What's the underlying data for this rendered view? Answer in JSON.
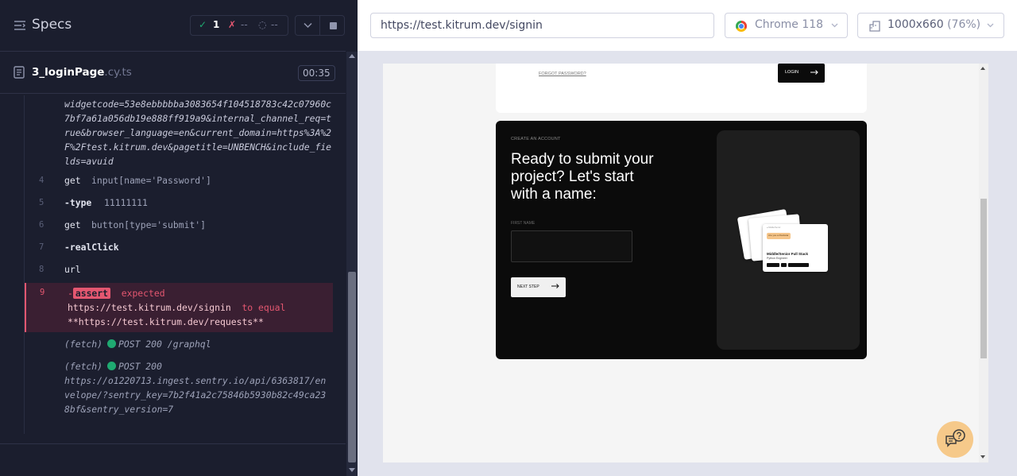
{
  "reporter": {
    "title": "Specs",
    "stats": {
      "passed": "1",
      "failed": "--",
      "pending": "--"
    },
    "spec": {
      "name": "3_loginPage",
      "ext": ".cy.ts",
      "duration": "00:35"
    },
    "commands": {
      "url_continuation": "widgetcode=53e8ebbbbba3083654f104518783c42c07960c7bf7a61a056db19e888ff919a9&internal_channel_req=true&browser_language=en&current_domain=https%3A%2F%2Ftest.kitrum.dev&pagetitle=UNBENCH&include_fields=avuid",
      "rows": [
        {
          "line": "4",
          "name": "get",
          "message": "input[name='Password']"
        },
        {
          "line": "5",
          "name": "-type",
          "message": "11111111"
        },
        {
          "line": "6",
          "name": "get",
          "message": "button[type='submit']"
        },
        {
          "line": "7",
          "name": "-realClick",
          "message": ""
        },
        {
          "line": "8",
          "name": "url",
          "message": ""
        }
      ],
      "assert": {
        "line": "9",
        "badge": "assert",
        "expected_label": "expected",
        "actual": "https://test.kitrum.dev/signin",
        "to_equal": "to equal",
        "expected": "**https://test.kitrum.dev/requests**"
      },
      "fetches": [
        {
          "label": "(fetch)",
          "method_status": "POST 200",
          "url": "/graphql"
        },
        {
          "label": "(fetch)",
          "method_status": "POST 200",
          "url": "https://o1220713.ingest.sentry.io/api/6363817/envelope/?sentry_key=7b2f41a2c75846b5930b82c49ca238bf&sentry_version=7"
        }
      ]
    }
  },
  "browser_bar": {
    "url": "https://test.kitrum.dev/signin",
    "browser": "Chrome 118",
    "viewport": "1000x660",
    "zoom": "(76%)",
    "icons": [
      "chrome-icon",
      "ruler-icon",
      "chevron-down-icon"
    ]
  },
  "aut": {
    "forgot_password": "FORGOT PASSWORD?",
    "login_button": "LOGIN",
    "create_kicker": "CREATE AN ACCOUNT",
    "create_title": "Ready to submit your project? Let's start with a name:",
    "first_name_label": "FIRST NAME",
    "first_name_value": "",
    "next_button": "NEXT STEP",
    "mini_card": {
      "header": "● Middle/Senior",
      "tag": "Are you a Rockstar",
      "title": "Middle/Senior Full Stack",
      "subtitle": "Python Engineer"
    }
  },
  "colors": {
    "reporter_bg": "#1b1e2e",
    "pass": "#1fa971",
    "fail": "#e45770",
    "aut_dark_card": "#0b0b0b",
    "help_button": "#f6c98a"
  }
}
